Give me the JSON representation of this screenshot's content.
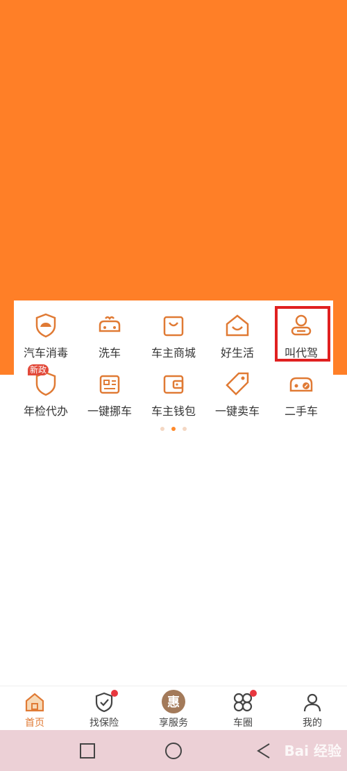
{
  "colors": {
    "hero": "#ff7f27",
    "accent": "#e07a34",
    "highlight": "#e02020",
    "badge": "#e24a3b"
  },
  "services": {
    "row1": [
      {
        "label": "汽车消毒",
        "icon": "shield-car-icon"
      },
      {
        "label": "洗车",
        "icon": "car-wash-icon"
      },
      {
        "label": "车主商城",
        "icon": "shopping-bag-icon"
      },
      {
        "label": "好生活",
        "icon": "house-smile-icon"
      },
      {
        "label": "叫代驾",
        "icon": "driver-icon"
      }
    ],
    "row2": [
      {
        "label": "年检代办",
        "icon": "inspection-shield-icon",
        "badge": "新政"
      },
      {
        "label": "一键挪车",
        "icon": "id-card-icon"
      },
      {
        "label": "车主钱包",
        "icon": "wallet-icon"
      },
      {
        "label": "一键卖车",
        "icon": "tag-icon"
      },
      {
        "label": "二手车",
        "icon": "used-car-icon"
      }
    ]
  },
  "tabs": [
    {
      "label": "首页",
      "icon": "home-icon",
      "active": true
    },
    {
      "label": "找保险",
      "icon": "shield-check-icon",
      "dot": true
    },
    {
      "label": "享服务",
      "icon": "hui-icon",
      "icon_text": "惠"
    },
    {
      "label": "车圈",
      "icon": "clover-icon",
      "dot": true
    },
    {
      "label": "我的",
      "icon": "user-icon"
    }
  ],
  "watermark": "Bai 经验"
}
